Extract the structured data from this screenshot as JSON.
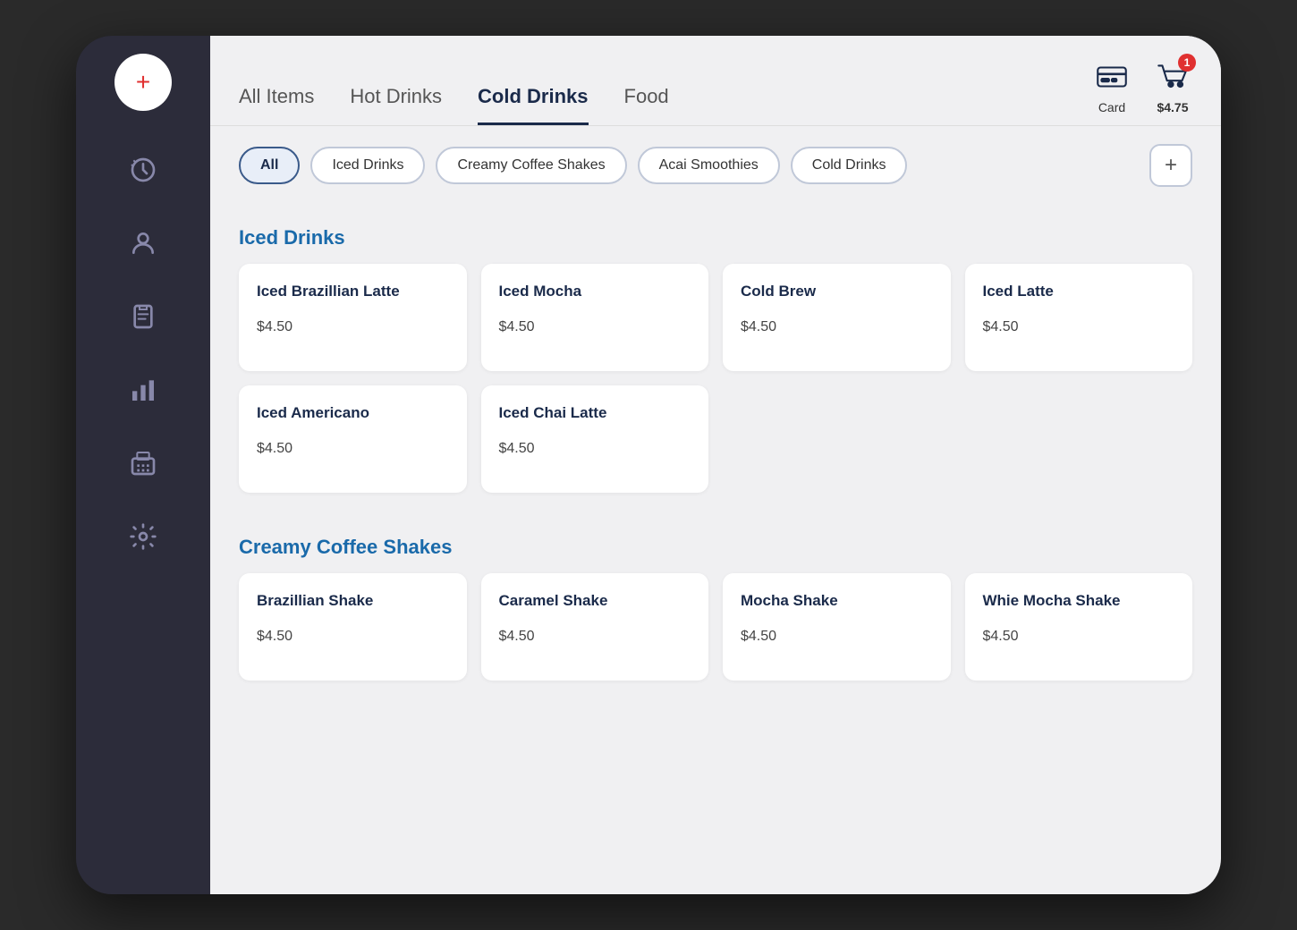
{
  "sidebar": {
    "add_label": "+",
    "icons": [
      {
        "name": "clock-icon",
        "label": "recent"
      },
      {
        "name": "user-icon",
        "label": "user"
      },
      {
        "name": "clipboard-icon",
        "label": "orders"
      },
      {
        "name": "chart-icon",
        "label": "reports"
      },
      {
        "name": "register-icon",
        "label": "register"
      },
      {
        "name": "settings-icon",
        "label": "settings"
      }
    ]
  },
  "top_nav": {
    "tabs": [
      {
        "label": "All Items",
        "active": false
      },
      {
        "label": "Hot Drinks",
        "active": false
      },
      {
        "label": "Cold Drinks",
        "active": true
      },
      {
        "label": "Food",
        "active": false
      }
    ],
    "card_label": "Card",
    "cart_price": "$4.75",
    "cart_badge": "1"
  },
  "filter_bar": {
    "filters": [
      {
        "label": "All",
        "active": true
      },
      {
        "label": "Iced Drinks",
        "active": false
      },
      {
        "label": "Creamy Coffee Shakes",
        "active": false
      },
      {
        "label": "Acai Smoothies",
        "active": false
      },
      {
        "label": "Cold Drinks",
        "active": false
      }
    ],
    "add_btn_label": "+"
  },
  "sections": [
    {
      "title": "Iced Drinks",
      "products": [
        {
          "name": "Iced Brazillian Latte",
          "price": "$4.50"
        },
        {
          "name": "Iced Mocha",
          "price": "$4.50"
        },
        {
          "name": "Cold Brew",
          "price": "$4.50"
        },
        {
          "name": "Iced Latte",
          "price": "$4.50"
        },
        {
          "name": "Iced Americano",
          "price": "$4.50"
        },
        {
          "name": "Iced Chai Latte",
          "price": "$4.50"
        }
      ]
    },
    {
      "title": "Creamy Coffee Shakes",
      "products": [
        {
          "name": "Brazillian Shake",
          "price": "$4.50"
        },
        {
          "name": "Caramel Shake",
          "price": "$4.50"
        },
        {
          "name": "Mocha Shake",
          "price": "$4.50"
        },
        {
          "name": "Whie Mocha Shake",
          "price": "$4.50"
        }
      ]
    }
  ]
}
